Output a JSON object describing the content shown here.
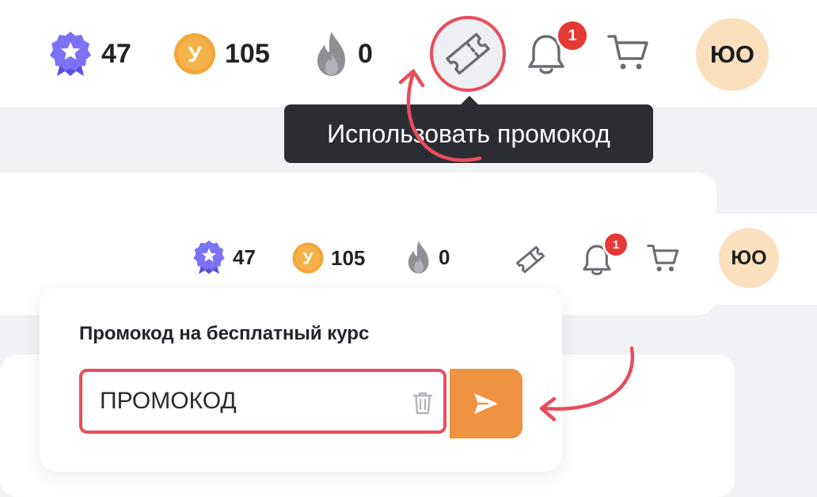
{
  "header_top": {
    "stats": [
      {
        "icon": "medal-star-icon",
        "value": "47"
      },
      {
        "icon": "coin-y-icon",
        "coin_letter": "У",
        "value": "105"
      },
      {
        "icon": "fire-icon",
        "value": "0"
      }
    ],
    "notifications_badge": "1",
    "avatar_initials": "ЮО",
    "tooltip": "Использовать промокод"
  },
  "header_bottom": {
    "stats": [
      {
        "icon": "medal-star-icon",
        "value": "47"
      },
      {
        "icon": "coin-y-icon",
        "coin_letter": "У",
        "value": "105"
      },
      {
        "icon": "fire-icon",
        "value": "0"
      }
    ],
    "notifications_badge": "1",
    "avatar_initials": "ЮО"
  },
  "promo_popup": {
    "title": "Промокод на бесплатный курс",
    "input_value": "ПРОМОКОД"
  },
  "colors": {
    "accent_orange": "#ef9342",
    "highlight_red": "#e84d5b",
    "badge_red": "#e53935",
    "avatar_bg": "#fbe0bd",
    "medal_purple": "#6f6cf0",
    "coin_orange": "#f2a63b"
  }
}
